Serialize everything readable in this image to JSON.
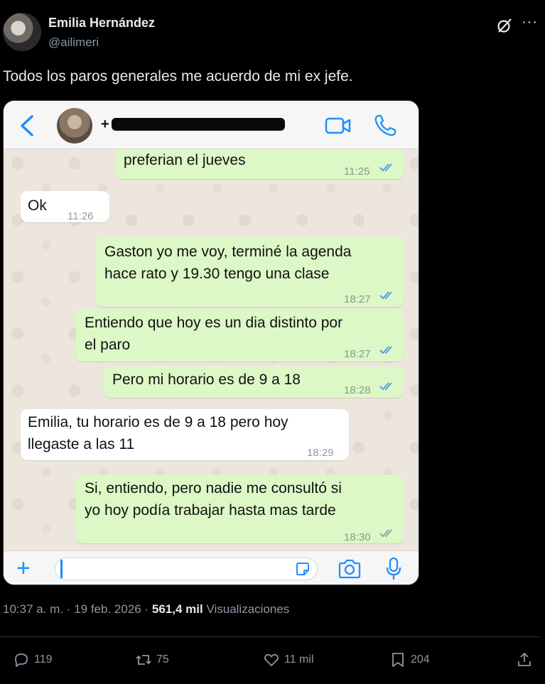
{
  "tweet": {
    "author_name": "Emilia Hernández",
    "author_handle": "@ailimeri",
    "text": "Todos los paros generales me acuerdo de mi ex jefe.",
    "more_label": "···",
    "time": "10:37 a. m.",
    "date": "19 feb. 2026",
    "separator": "·",
    "views_count": "561,4 mil",
    "views_label": "Visualizaciones",
    "actions": {
      "replies": "119",
      "retweets": "75",
      "likes": "11 mil",
      "bookmarks": "204"
    }
  },
  "whatsapp": {
    "contact_prefix": "+",
    "messages": [
      {
        "direction": "out",
        "text": "preferian el jueves",
        "time": "11:25",
        "status": "read"
      },
      {
        "direction": "in",
        "text": "Ok",
        "time": "11:26"
      },
      {
        "direction": "out",
        "text": "Gaston yo me voy, terminé la agenda\nhace rato y 19.30 tengo una clase",
        "time": "18:27",
        "status": "read"
      },
      {
        "direction": "out",
        "text": "Entiendo que hoy es un dia distinto por\nel paro",
        "time": "18:27",
        "status": "read"
      },
      {
        "direction": "out",
        "text": "Pero mi horario es de 9 a 18",
        "time": "18:28",
        "status": "read"
      },
      {
        "direction": "in",
        "text": "Emilia, tu horario es de 9 a 18 pero hoy\nllegaste a las 11",
        "time": "18:29"
      },
      {
        "direction": "out",
        "text": "Si, entiendo, pero nadie me consultó si\nyo hoy podía trabajar hasta mas tarde",
        "time": "18:30",
        "status": "delivered"
      }
    ]
  },
  "colors": {
    "background": "#000000",
    "text_primary": "#e7e9ea",
    "text_secondary": "#8b98a5",
    "bubble_out": "#dcf8c6",
    "bubble_in": "#ffffff",
    "wa_accent": "#1f8fff",
    "tick_read": "#4fa3e0",
    "tick_delivered": "#9aa0a6"
  }
}
